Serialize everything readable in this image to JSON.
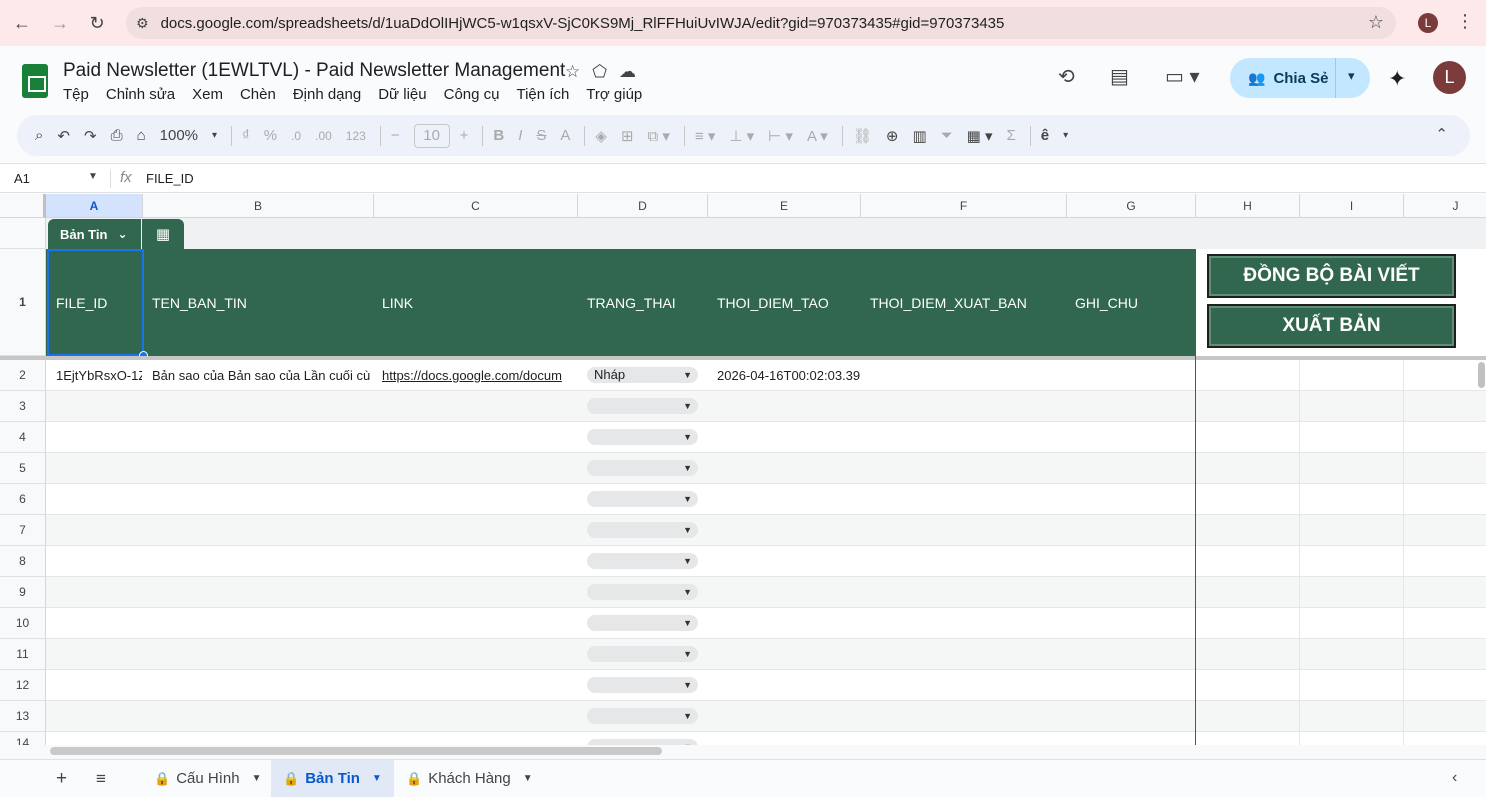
{
  "browser": {
    "url": "docs.google.com/spreadsheets/d/1uaDdOlIHjWC5-w1qsxV-SjC0KS9Mj_RlFFHuiUvIWJA/edit?gid=970373435#gid=970373435",
    "profile_initial": "L"
  },
  "doc": {
    "title": "Paid Newsletter (1EWLTVL) - Paid Newsletter Management",
    "menu": [
      "Tệp",
      "Chỉnh sửa",
      "Xem",
      "Chèn",
      "Định dạng",
      "Dữ liệu",
      "Công cụ",
      "Tiện ích",
      "Trợ giúp"
    ],
    "share_label": "Chia Sẻ",
    "avatar_initial": "L"
  },
  "toolbar": {
    "zoom": "100%",
    "font_size": "10",
    "currency": "₫",
    "percent": "%",
    "dec_decrease": ".0",
    "dec_increase": ".00",
    "number_format": "123",
    "bold": "B",
    "italic": "I",
    "strike": "S",
    "text_color": "A",
    "input_tool": "ê"
  },
  "formula_bar": {
    "cell_ref": "A1",
    "fx": "fx",
    "content": "FILE_ID"
  },
  "grid": {
    "columns": [
      "A",
      "B",
      "C",
      "D",
      "E",
      "F",
      "G",
      "H",
      "I",
      "J"
    ],
    "rows": [
      "1",
      "2",
      "3",
      "4",
      "5",
      "6",
      "7",
      "8",
      "9",
      "10",
      "11",
      "12",
      "13",
      "14"
    ],
    "table_name": "Bản Tin",
    "headers": [
      "FILE_ID",
      "TEN_BAN_TIN",
      "LINK",
      "TRANG_THAI",
      "THOI_DIEM_TAO",
      "THOI_DIEM_XUAT_BAN",
      "GHI_CHU"
    ],
    "row2": {
      "file_id": "1EjtYbRsxO-1Z",
      "ten_ban_tin": "Bản sao của Bản sao của Lần cuối cù",
      "link": "https://docs.google.com/docum",
      "trang_thai": "Nháp",
      "thoi_diem_tao": "2026-04-16T00:02:03.39"
    },
    "buttons": [
      "ĐỒNG BỘ BÀI VIẾT",
      "XUẤT BẢN"
    ]
  },
  "sheets": [
    {
      "name": "Cấu Hình",
      "active": false
    },
    {
      "name": "Bản Tin",
      "active": true
    },
    {
      "name": "Khách Hàng",
      "active": false
    }
  ]
}
